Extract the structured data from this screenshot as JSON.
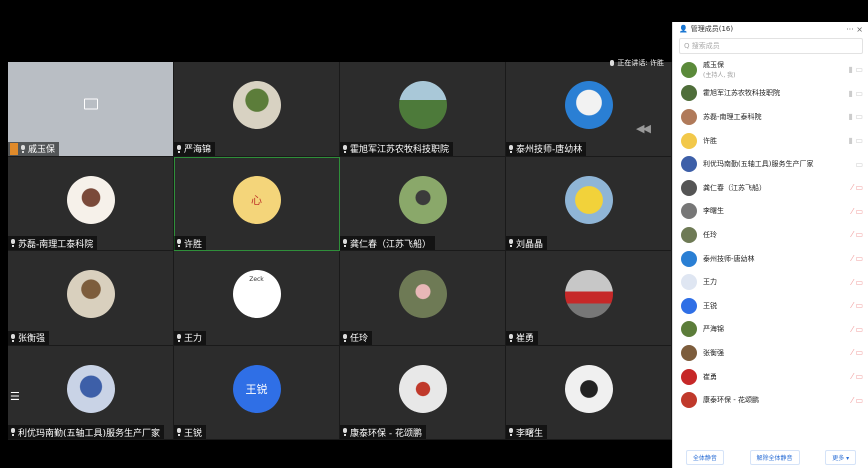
{
  "participants_panel": {
    "title": "管理成员(16)",
    "search_placeholder": "Q 搜索成员",
    "window_controls": "··· ×",
    "members": [
      {
        "name": "戚玉保",
        "sub": "(主持人, 我)"
      },
      {
        "name": "霍旭军江苏农牧科技职院",
        "sub": ""
      },
      {
        "name": "苏磊-南理工泰科院",
        "sub": ""
      },
      {
        "name": "许胜",
        "sub": ""
      },
      {
        "name": "利优玛南勤(五轴工具)服务生产厂家",
        "sub": ""
      },
      {
        "name": "龚仁春（江苏飞船）",
        "sub": ""
      },
      {
        "name": "李曙生",
        "sub": ""
      },
      {
        "name": "任玲",
        "sub": ""
      },
      {
        "name": "泰州技师-唐幼林",
        "sub": ""
      },
      {
        "name": "王力",
        "sub": ""
      },
      {
        "name": "王锐",
        "sub": ""
      },
      {
        "name": "严海锦",
        "sub": ""
      },
      {
        "name": "张衡强",
        "sub": ""
      },
      {
        "name": "崔勇",
        "sub": ""
      },
      {
        "name": "康泰环保 - 花颂鹏",
        "sub": ""
      }
    ],
    "footer": {
      "mute_all": "全体静音",
      "unmute_all": "解除全体静音",
      "more": "更多 ▾"
    }
  },
  "speaking_indicator": "正在讲话: 许胜",
  "grid": [
    {
      "name": "戚玉保",
      "host": true,
      "avatar_text": ""
    },
    {
      "name": "严海锦",
      "avatar_text": ""
    },
    {
      "name": "霍旭军江苏农牧科技职院",
      "avatar_text": ""
    },
    {
      "name": "泰州技师-唐幼林",
      "avatar_text": ""
    },
    {
      "name": "苏磊-南理工泰科院",
      "avatar_text": ""
    },
    {
      "name": "许胜",
      "avatar_text": "心"
    },
    {
      "name": "龚仁春（江苏飞船）",
      "avatar_text": ""
    },
    {
      "name": "刘晶晶",
      "avatar_text": ""
    },
    {
      "name": "张衡强",
      "avatar_text": ""
    },
    {
      "name": "王力",
      "avatar_text": "Zeck"
    },
    {
      "name": "任玲",
      "avatar_text": ""
    },
    {
      "name": "崔勇",
      "avatar_text": ""
    },
    {
      "name": "利优玛南勤(五轴工具)服务生产厂家",
      "avatar_text": ""
    },
    {
      "name": "王锐",
      "avatar_text": "王锐"
    },
    {
      "name": "康泰环保 - 花颂鹏",
      "avatar_text": ""
    },
    {
      "name": "李曙生",
      "avatar_text": ""
    }
  ],
  "colors": {
    "accent_green": "#3aa845",
    "avatar_blue": "#2f6fe6",
    "host_orange": "#e08a2a",
    "panel_link": "#2c6fd6"
  }
}
